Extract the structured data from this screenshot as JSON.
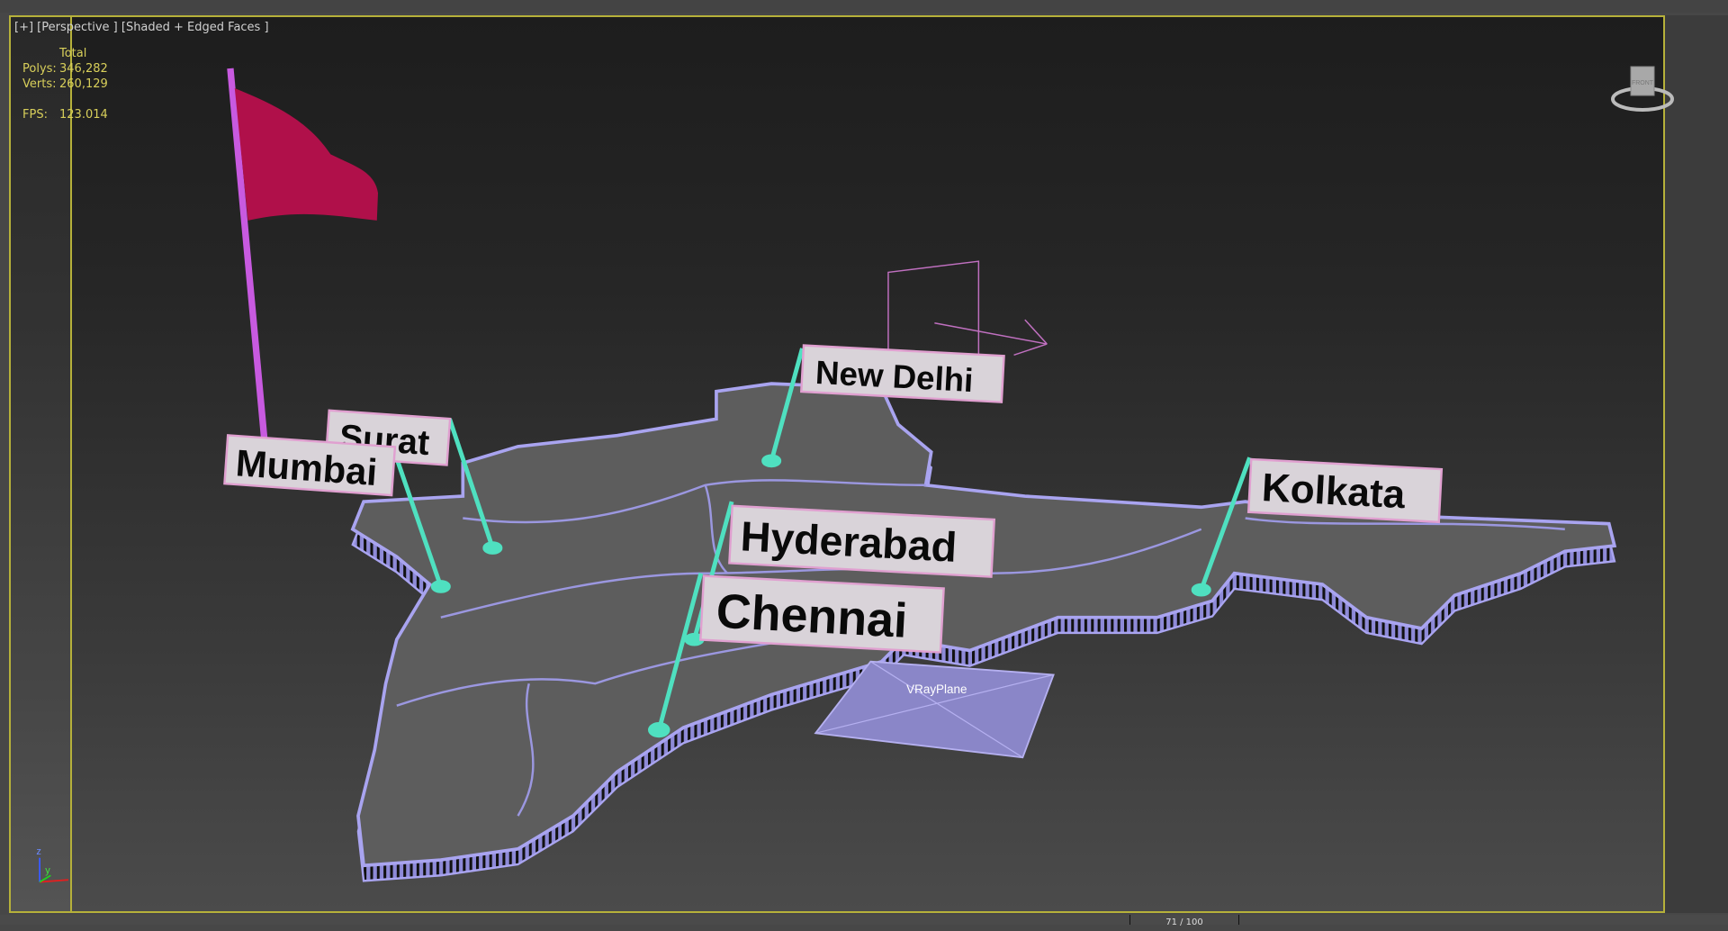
{
  "viewport": {
    "label": "[+] [Perspective ] [Shaded + Edged Faces ]",
    "stats": {
      "header": "Total",
      "polys_label": "Polys:",
      "polys_value": "346,282",
      "verts_label": "Verts:",
      "verts_value": "260,129",
      "fps_label": "FPS:",
      "fps_value": "123.014"
    }
  },
  "viewcube": {
    "face_label": "FRONT"
  },
  "scene": {
    "cities": [
      {
        "name": "New Delhi"
      },
      {
        "name": "Surat"
      },
      {
        "name": "Mumbai"
      },
      {
        "name": "Hyderabad"
      },
      {
        "name": "Chennai"
      },
      {
        "name": "Kolkata"
      }
    ],
    "plane_label": "VRayPlane",
    "axis": {
      "z": "z",
      "y": "y"
    }
  },
  "timeline": {
    "frame": "71 / 100"
  },
  "colors": {
    "frame": "#b6b13a",
    "map_fill": "#5d5d5d",
    "map_edge": "#a9a4f0",
    "pin": "#4fe0c0",
    "flag": "#b0104a",
    "pole": "#c85ae0",
    "label_bg": "#d9d3d9"
  }
}
